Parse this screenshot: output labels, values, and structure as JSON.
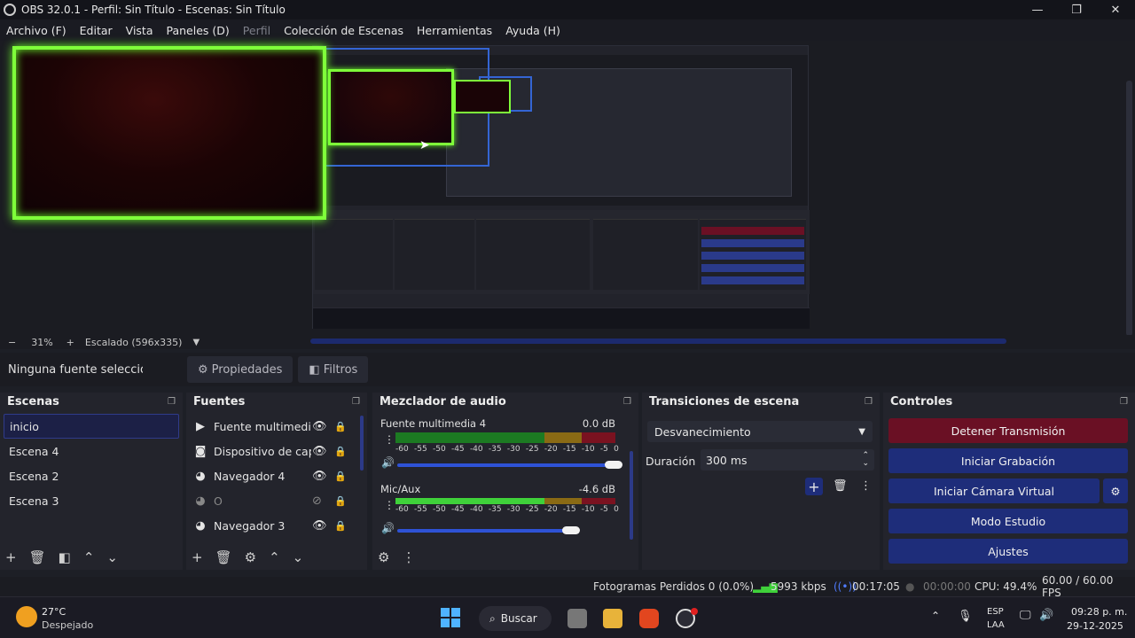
{
  "window": {
    "title": "OBS 32.0.1 - Perfil: Sin Título - Escenas: Sin Título",
    "minimize": "—",
    "maximize": "❐",
    "close": "✕"
  },
  "menu": [
    "Archivo (F)",
    "Editar",
    "Vista",
    "Paneles (D)",
    "Perfil",
    "Colección de Escenas",
    "Herramientas",
    "Ayuda (H)"
  ],
  "zoom": {
    "minus": "−",
    "percent": "31%",
    "plus": "+",
    "scale_label": "Escalado (596x335)"
  },
  "source_toolbar": {
    "no_selection": "Ninguna fuente seleccionada",
    "properties": "Propiedades",
    "filters": "Filtros"
  },
  "scenes": {
    "title": "Escenas",
    "items": [
      "inicio",
      "Escena 4",
      "Escena 2",
      "Escena 3"
    ],
    "selected": "inicio"
  },
  "sources": {
    "title": "Fuentes",
    "items": [
      {
        "label": "Fuente multimedia",
        "icon": "play-icon",
        "visible": true
      },
      {
        "label": "Dispositivo de captura",
        "icon": "camera-icon",
        "visible": true
      },
      {
        "label": "Navegador 4",
        "icon": "globe-icon",
        "visible": true
      },
      {
        "label": "O",
        "icon": "globe-icon",
        "visible": false
      },
      {
        "label": "Navegador 3",
        "icon": "globe-icon",
        "visible": true
      }
    ]
  },
  "mixer": {
    "title": "Mezclador de audio",
    "scale": [
      "-60",
      "-55",
      "-50",
      "-45",
      "-40",
      "-35",
      "-30",
      "-25",
      "-20",
      "-15",
      "-10",
      "-5",
      "0"
    ],
    "channels": [
      {
        "name": "Fuente multimedia 4",
        "db": "0.0 dB",
        "volume": 1.0
      },
      {
        "name": "Mic/Aux",
        "db": "-4.6 dB",
        "volume": 0.79
      }
    ]
  },
  "transitions": {
    "title": "Transiciones de escena",
    "selected": "Desvanecimiento",
    "duration_label": "Duración",
    "duration_value": "300 ms"
  },
  "controls": {
    "title": "Controles",
    "stop_stream": "Detener Transmisión",
    "start_recording": "Iniciar Grabación",
    "start_virtual_cam": "Iniciar Cámara Virtual",
    "studio_mode": "Modo Estudio",
    "settings": "Ajustes"
  },
  "status": {
    "dropped_frames": "Fotogramas Perdidos 0 (0.0%)",
    "bitrate": "5993 kbps",
    "stream_time": "00:17:05",
    "rec_time": "00:00:00",
    "cpu": "CPU: 49.4%",
    "fps": "60.00 / 60.00 FPS"
  },
  "taskbar": {
    "temperature": "27°C",
    "weather": "Despejado",
    "search": "Buscar",
    "language_top": "ESP",
    "language_bottom": "LAA",
    "time": "09:28 p. m.",
    "date": "29-12-2025"
  },
  "colors": {
    "stop_stream_bg": "#6a1024",
    "button_bg": "#1e2d7a",
    "accent_blue": "#2e52d6",
    "frame_green": "#7fff3a"
  }
}
